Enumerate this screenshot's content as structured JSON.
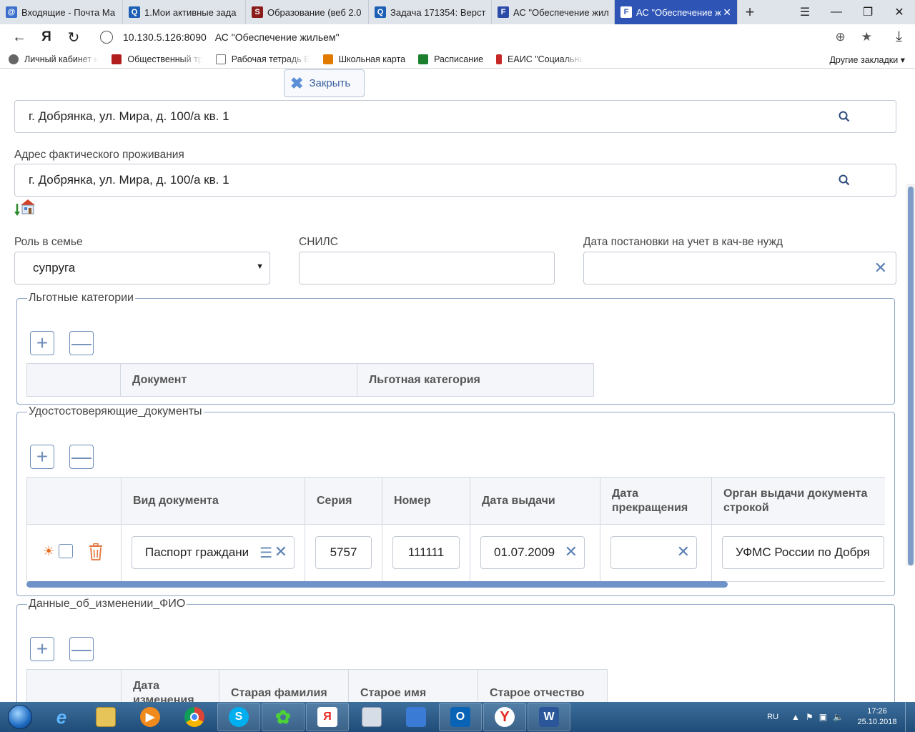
{
  "browser": {
    "tabs": [
      {
        "title": "Входящие - Почта Ма",
        "color": "#3b6fcb",
        "glyph": "@"
      },
      {
        "title": "1.Мои активные зада",
        "color": "#1d5fb4",
        "glyph": "Q"
      },
      {
        "title": "Образование (веб 2.0",
        "color": "#8a1c1c",
        "glyph": "S"
      },
      {
        "title": "Задача 171354: Верст",
        "color": "#1d5fb4",
        "glyph": "Q"
      },
      {
        "title": "АС \"Обеспечение жил",
        "color": "#2c4aa8",
        "glyph": "F"
      },
      {
        "title": "АС \"Обеспечение ж",
        "color": "#ffffff",
        "glyph": "F",
        "active": true
      }
    ],
    "url_host": "10.130.5.126:8090",
    "url_title": "АС \"Обеспечение жильем\"",
    "bookmarks": [
      {
        "label": "Личный кабинет н",
        "color": "#666666"
      },
      {
        "label": "Общественный тр",
        "color": "#b21e1e"
      },
      {
        "label": "Рабочая тетрадь Е",
        "color": "#777777"
      },
      {
        "label": "Школьная карта",
        "color": "#e07b00"
      },
      {
        "label": "Расписание",
        "color": "#1b7f2d"
      },
      {
        "label": "ЕАИС \"Социальнь",
        "color": "#c62828"
      }
    ],
    "other_bookmarks": "Другие закладки"
  },
  "form": {
    "close_label": "Закрыть",
    "reg_address_value": "г. Добрянка, ул. Мира, д. 100/а кв. 1",
    "actual_address_label": "Адрес фактического проживания",
    "actual_address_value": "г. Добрянка, ул. Мира, д. 100/а кв. 1",
    "role_label": "Роль в семье",
    "role_value": "супруга",
    "snils_label": "СНИЛС",
    "snils_value": "",
    "reg_date_label": "Дата постановки на учет в кач-ве нужд",
    "reg_date_value": ""
  },
  "benefits": {
    "title": "Льготные категории",
    "columns": [
      "Документ",
      "Льготная категория"
    ]
  },
  "id_docs": {
    "title": "Удостоcтоверяющие_документы",
    "columns": [
      "Вид документа",
      "Серия",
      "Номер",
      "Дата выдачи",
      "Дата прекращения",
      "Орган выдачи документа строкой"
    ],
    "row": {
      "doc_type": "Паспорт граждани",
      "series": "5757",
      "number": "111111",
      "issue_date": "01.07.2009",
      "end_date": "",
      "issuer": "УФМС России по Добря"
    }
  },
  "name_change": {
    "title": "Данные_об_изменении_ФИО",
    "columns": [
      "Дата изменения",
      "Старая фамилия",
      "Старое имя",
      "Старое отчество"
    ]
  },
  "taskbar": {
    "lang": "RU",
    "time": "17:26",
    "date": "25.10.2018"
  }
}
